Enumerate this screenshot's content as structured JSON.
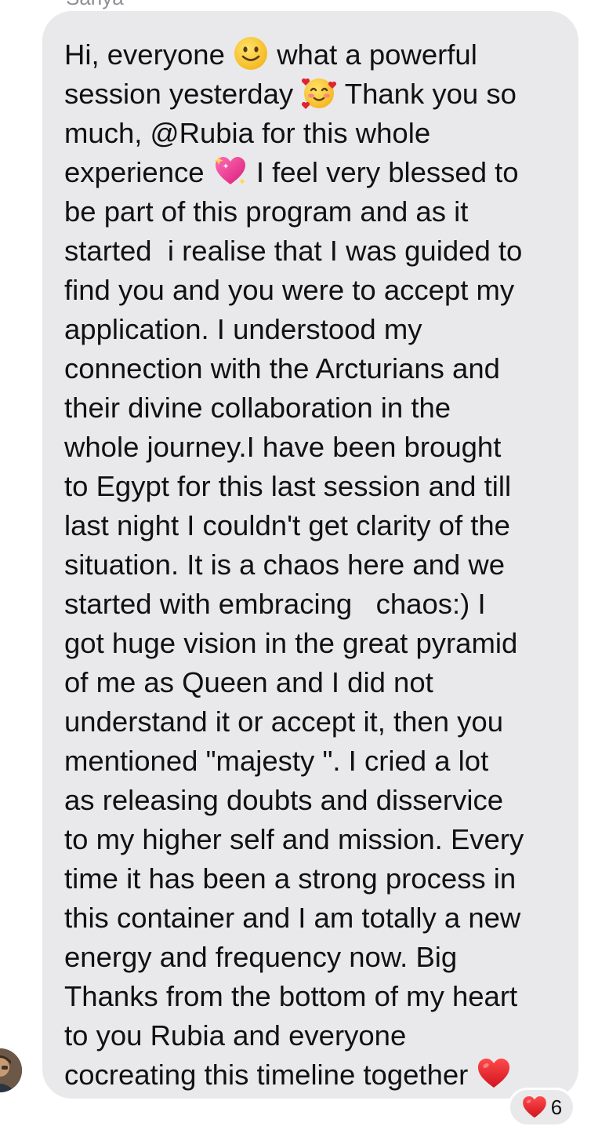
{
  "sender": {
    "name": "Sanya"
  },
  "message": {
    "lines": [
      {
        "text_a": "Hi, everyone ",
        "emoji": "slightly-smiling-face-icon",
        "text_b": " what a powerful"
      },
      {
        "text_a": "session yesterday ",
        "emoji": "smiling-face-with-hearts-icon",
        "text_b": " Thank you so"
      },
      {
        "text_a": "much, @Rubia for this whole"
      },
      {
        "text_a": "experience ",
        "emoji": "sparkling-heart-icon",
        "text_b": " I feel very blessed to"
      },
      {
        "text_a": "be part of this program and as it"
      },
      {
        "text_a": "started  i realise that I was guided to"
      },
      {
        "text_a": "find you and you were to accept my"
      },
      {
        "text_a": "application. I understood my"
      },
      {
        "text_a": "connection with the Arcturians and"
      },
      {
        "text_a": "their divine collaboration in the"
      },
      {
        "text_a": "whole journey.I have been brought"
      },
      {
        "text_a": "to Egypt for this last session and till"
      },
      {
        "text_a": "last night I couldn't get clarity of the"
      },
      {
        "text_a": "situation. It is a chaos here and we"
      },
      {
        "text_a": "started with embracing   chaos:) I"
      },
      {
        "text_a": "got huge vision in the great pyramid"
      },
      {
        "text_a": "of me as Queen and I did not"
      },
      {
        "text_a": "understand it or accept it, then you"
      },
      {
        "text_a": "mentioned \"majesty \". I cried a lot"
      },
      {
        "text_a": "as releasing doubts and disservice"
      },
      {
        "text_a": "to my higher self and mission. Every"
      },
      {
        "text_a": "time it has been a strong process in"
      },
      {
        "text_a": "this container and I am totally a new"
      },
      {
        "text_a": "energy and frequency now. Big"
      },
      {
        "text_a": "Thanks from the bottom of my heart"
      },
      {
        "text_a": "to you Rubia and everyone"
      },
      {
        "text_a": "cocreating this timeline together ",
        "emoji": "red-heart-icon"
      }
    ]
  },
  "reaction": {
    "emoji": "red-heart-icon",
    "count": "6"
  },
  "colors": {
    "bubble": "#e9e9eb",
    "text": "#111111",
    "secondary_text": "#8e8e93",
    "heart": "#e0242f"
  }
}
